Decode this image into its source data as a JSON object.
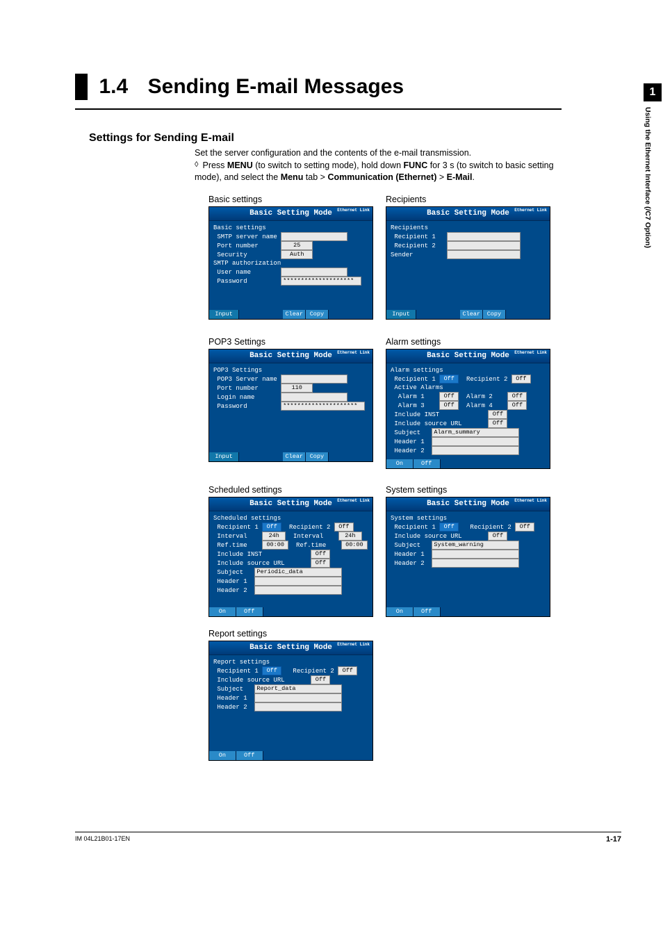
{
  "chapter": {
    "number": "1",
    "side_text": "Using the Ethernet Interface (/C7 Option)"
  },
  "heading": {
    "num": "1.4",
    "title": "Sending E-mail Messages"
  },
  "subheading": "Settings for Sending E-mail",
  "intro": {
    "line1": "Set the server configuration and the contents of the e-mail transmission.",
    "line2_pre": "Press ",
    "menu": "MENU",
    "line2_mid": " (to switch to setting mode), hold down ",
    "func": "FUNC",
    "line2_post": " for 3 s (to switch to basic setting mode), and select the ",
    "menu_tab": "Menu",
    "gt1": " tab > ",
    "comm": "Communication (Ethernet)",
    "gt2": " > ",
    "email": "E-Mail",
    "period": "."
  },
  "panel_title": "Basic Setting Mode",
  "led": "Ethernet\nLink",
  "footer_btn": {
    "input": "Input",
    "clear": "Clear",
    "copy": "Copy",
    "on": "On",
    "off": "Off"
  },
  "panels": {
    "basic": {
      "caption": "Basic settings",
      "lines": {
        "l1": "Basic settings",
        "l2": " SMTP server name",
        "l3": " Port number",
        "l4": " Security",
        "l5": "SMTP authorization",
        "l6": " User name",
        "l7": " Password"
      },
      "vals": {
        "server": "",
        "port": "25",
        "security": "Auth",
        "user": "",
        "pass": "********************"
      }
    },
    "recipients": {
      "caption": "Recipients",
      "lines": {
        "l1": "Recipients",
        "l2": " Recipient 1",
        "l3": " Recipient 2",
        "l4": "Sender"
      },
      "vals": {
        "r1": "",
        "r2": "",
        "sender": ""
      }
    },
    "pop3": {
      "caption": "POP3 Settings",
      "lines": {
        "l1": "POP3 Settings",
        "l2": " POP3 Server name",
        "l3": " Port number",
        "l4": " Login name",
        "l5": " Password"
      },
      "vals": {
        "server": "",
        "port": "110",
        "login": "",
        "pass": "*********************"
      }
    },
    "alarm": {
      "caption": "Alarm settings",
      "lines": {
        "l1": "Alarm settings",
        "l2": " Recipient 1",
        "l2b": "Recipient 2",
        "l3": " Active Alarms",
        "l4": "  Alarm 1",
        "l4b": "Alarm 2",
        "l5": "  Alarm 3",
        "l5b": "Alarm 4",
        "l6": " Include INST",
        "l7": " Include source URL",
        "l8": " Subject",
        "l9": " Header 1",
        "l10": " Header 2"
      },
      "vals": {
        "r1": "Off",
        "r2": "Off",
        "a1": "Off",
        "a2": "Off",
        "a3": "Off",
        "a4": "Off",
        "inst": "Off",
        "url": "Off",
        "subject": "Alarm_summary",
        "h1": "",
        "h2": ""
      }
    },
    "scheduled": {
      "caption": "Scheduled settings",
      "lines": {
        "l1": "Scheduled settings",
        "l2": " Recipient 1",
        "l2b": "Recipient 2",
        "l3": " Interval",
        "l3b": "Interval",
        "l4": " Ref.time",
        "l4b": "Ref.time",
        "l5": " Include INST",
        "l6": " Include source URL",
        "l7": " Subject",
        "l8": " Header 1",
        "l9": " Header 2"
      },
      "vals": {
        "r1": "Off",
        "r2": "Off",
        "int1": "24h",
        "int2": "24h",
        "rt1": "00:00",
        "rt2": "00:00",
        "inst": "Off",
        "url": "Off",
        "subject": "Periodic_data",
        "h1": "",
        "h2": ""
      }
    },
    "system": {
      "caption": "System settings",
      "lines": {
        "l1": "System settings",
        "l2": " Recipient 1",
        "l2b": "Recipient 2",
        "l3": " Include source URL",
        "l4": " Subject",
        "l5": " Header 1",
        "l6": " Header 2"
      },
      "vals": {
        "r1": "Off",
        "r2": "Off",
        "url": "Off",
        "subject": "System_warning",
        "h1": "",
        "h2": ""
      }
    },
    "report": {
      "caption": "Report settings",
      "lines": {
        "l1": "Report settings",
        "l2": " Recipient 1",
        "l2b": "Recipient 2",
        "l3": " Include source URL",
        "l4": " Subject",
        "l5": " Header 1",
        "l6": " Header 2"
      },
      "vals": {
        "r1": "Off",
        "r2": "Off",
        "url": "Off",
        "subject": "Report_data",
        "h1": "",
        "h2": ""
      }
    }
  },
  "footer": {
    "doc": "IM 04L21B01-17EN",
    "page": "1-17"
  }
}
